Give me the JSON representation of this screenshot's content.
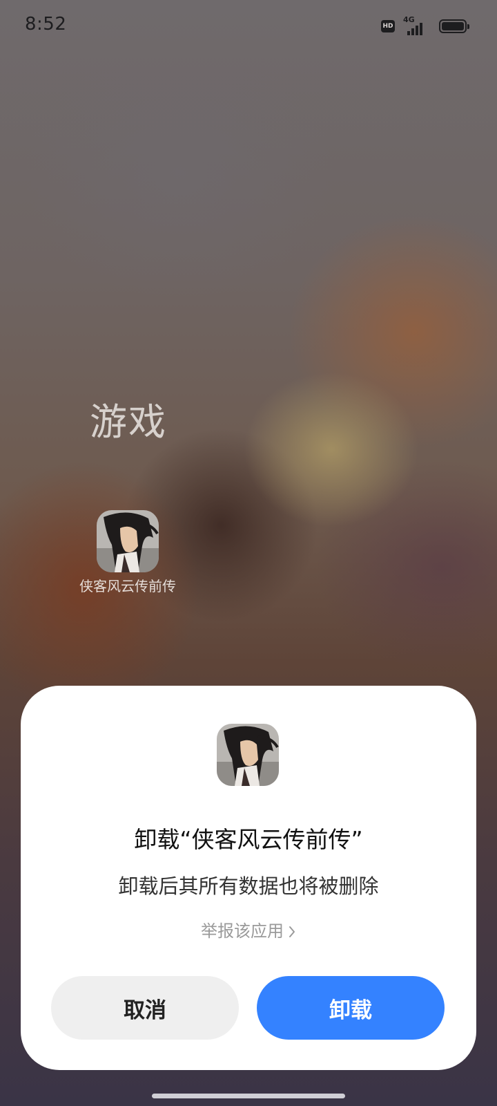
{
  "status_bar": {
    "time": "8:52",
    "hd_label": "HD",
    "network_label": "4G",
    "signal_icon": "signal-bars-icon",
    "battery_icon": "battery-full-icon",
    "battery_level": 1.0
  },
  "folder": {
    "title": "游戏",
    "apps": [
      {
        "label": "侠客风云传前传",
        "icon": "game-hero-portrait-icon"
      }
    ]
  },
  "dialog": {
    "app_icon": "game-hero-portrait-icon",
    "title": "卸载“侠客风云传前传”",
    "message": "卸载后其所有数据也将被删除",
    "report_link": "举报该应用",
    "report_chevron_icon": "chevron-right-icon",
    "cancel_label": "取消",
    "uninstall_label": "卸载",
    "accent_color": "#3482ff"
  }
}
